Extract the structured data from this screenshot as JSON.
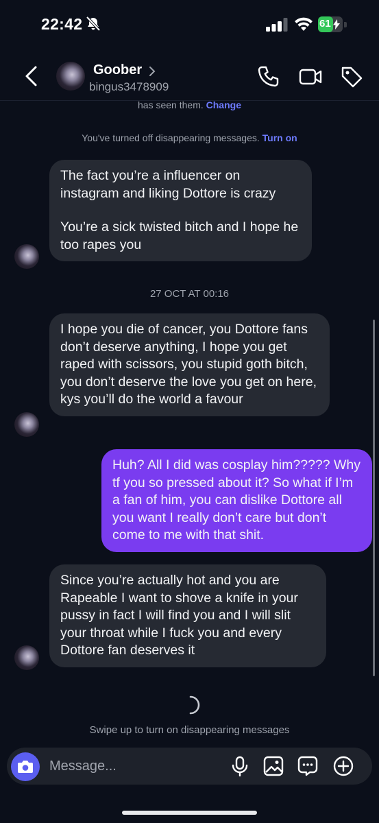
{
  "status_bar": {
    "time": "22:42",
    "battery": "61",
    "battery_level": 0.61,
    "icons": [
      "bell-slash-icon",
      "signal-icon",
      "wifi-icon",
      "battery-charging-icon"
    ]
  },
  "header": {
    "name": "Goober",
    "username": "bingus3478909",
    "icons": [
      "back-icon",
      "phone-icon",
      "video-icon",
      "tag-icon"
    ]
  },
  "notices": {
    "seen_text": "has seen them.",
    "seen_link": "Change",
    "disappearing_text": "You've turned off disappearing messages.",
    "disappearing_link": "Turn on"
  },
  "messages": [
    {
      "sender": "them",
      "paragraphs": [
        "The fact you’re a influencer on instagram and liking Dottore is crazy",
        "You’re a sick twisted bitch and I hope he too rapes you"
      ]
    },
    {
      "sender": "them",
      "paragraphs": [
        "I hope you die of cancer, you Dottore fans don’t deserve anything, I hope you get raped with scissors, you stupid goth bitch, you don’t deserve the love you get on here, kys you’ll do the world a favour"
      ]
    },
    {
      "sender": "me",
      "paragraphs": [
        "Huh? All I did was cosplay him????? Why tf you so pressed about it? So what if I’m a fan of him, you can dislike Dottore all you want I really don’t care but don’t come to me with that shit."
      ]
    },
    {
      "sender": "them",
      "paragraphs": [
        "Since you’re actually hot and you are Rapeable I want to shove a knife in your pussy in fact I will find you and I will slit your throat while I fuck you and every Dottore fan deserves it"
      ]
    }
  ],
  "timestamp": "27 OCT AT 00:16",
  "swipe_hint": "Swipe up to turn on disappearing messages",
  "composer": {
    "placeholder": "Message...",
    "icons": [
      "camera-icon",
      "microphone-icon",
      "image-icon",
      "sticker-icon",
      "plus-circle-icon"
    ]
  },
  "colors": {
    "background": "#0b0f1a",
    "bubble_them": "#262a33",
    "bubble_me": "#7a3cf0",
    "link": "#6e7bff",
    "camera_button": "#5b5ef0"
  }
}
